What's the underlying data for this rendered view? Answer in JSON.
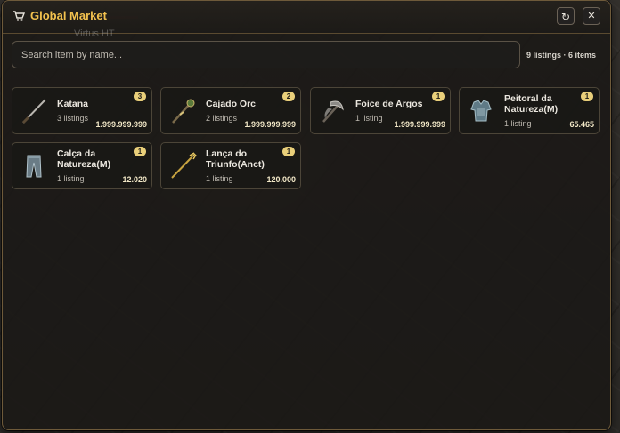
{
  "window": {
    "title": "Global Market",
    "background_name": "Virtus HT"
  },
  "search": {
    "placeholder": "Search item by name..."
  },
  "summary": "9 listings · 6 items",
  "colors": {
    "title": "#f2c14e",
    "badge": "#e9cf7a",
    "price": "#f3e9c8"
  },
  "items": [
    {
      "name": "Katana",
      "listings": "3 listings",
      "price": "1.999.999.999",
      "badge": "3",
      "icon": "katana-icon"
    },
    {
      "name": "Cajado Orc",
      "listings": "2 listings",
      "price": "1.999.999.999",
      "badge": "2",
      "icon": "orc-staff-icon"
    },
    {
      "name": "Foice de Argos",
      "listings": "1 listing",
      "price": "1.999.999.999",
      "badge": "1",
      "icon": "argos-scythe-icon"
    },
    {
      "name": "Peitoral da Natureza(M)",
      "listings": "1 listing",
      "price": "65.465",
      "badge": "1",
      "icon": "nature-chestplate-icon"
    },
    {
      "name": "Calça da Natureza(M)",
      "listings": "1 listing",
      "price": "12.020",
      "badge": "1",
      "icon": "nature-pants-icon"
    },
    {
      "name": "Lança do Triunfo(Anct)",
      "listings": "1 listing",
      "price": "120.000",
      "badge": "1",
      "icon": "triumph-lance-icon"
    }
  ]
}
